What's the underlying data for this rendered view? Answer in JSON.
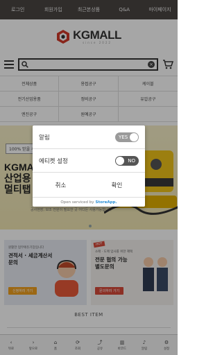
{
  "topnav": {
    "items": [
      "로그인",
      "회원가입",
      "최근본상품",
      "Q&A",
      "마이페이지"
    ]
  },
  "logo": {
    "name": "KGMALL",
    "sub": "since 2022"
  },
  "categories": [
    "전체상품",
    "용접공구",
    "케이블",
    "전기산업용품",
    "정비공구",
    "유압공구",
    "엔진공구",
    "원예공구",
    ""
  ],
  "banner": {
    "tag": "100% 믿을 수",
    "headline_line1": "KGMAL",
    "headline_line2": "산업용",
    "headline_line3": "멀티탭 ·",
    "small": "공사현장, 보조 전원이 필요한 곳\n어디든 사용가능합니다"
  },
  "promos": {
    "left": {
      "t1": "원활한 업무에듀기장입니다",
      "t2a": "견적서 · 세금계산서",
      "t2b": "문의",
      "btn": "신청하러 가기"
    },
    "right": {
      "badge": "HOT",
      "t1": "소매 · 도매 입사를 위한 혜택",
      "t2a": "전문 협의 가능",
      "t2b": "별도문의",
      "btn": "문의하러 가기"
    }
  },
  "best_item": "BEST ITEM",
  "bottombar": [
    {
      "icon": "‹",
      "label": "뒤로"
    },
    {
      "icon": "›",
      "label": "앞으로"
    },
    {
      "icon": "⌂",
      "label": "홈"
    },
    {
      "icon": "⟳",
      "label": "조회"
    },
    {
      "icon": "⤴",
      "label": "공유"
    },
    {
      "icon": "▥",
      "label": "바코드"
    },
    {
      "icon": "♪",
      "label": "알림"
    },
    {
      "icon": "⚙",
      "label": "설정"
    }
  ],
  "dialog": {
    "row1_label": "알림",
    "row1_toggle": "YES",
    "row2_label": "에티켓 설정",
    "row2_toggle": "NO",
    "cancel": "취소",
    "confirm": "확인",
    "footer_prefix": "Open serviced by",
    "footer_brand": "StoreApp."
  }
}
